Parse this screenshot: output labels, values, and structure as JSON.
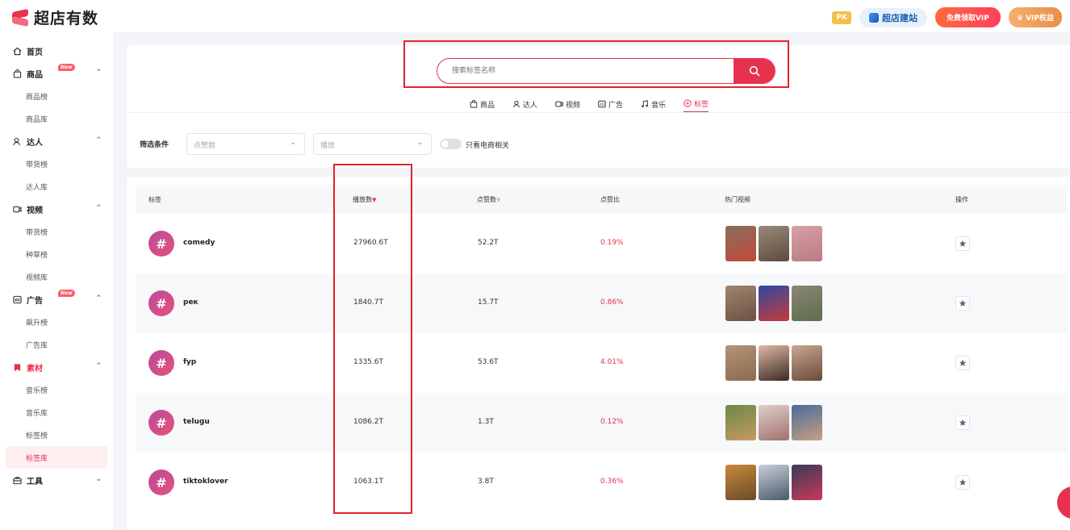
{
  "brand": {
    "name": "超店有数"
  },
  "topbar": {
    "pk": "PK",
    "site_builder": "超店建站",
    "free_vip": "免费领取VIP",
    "vip_rights": "VIP权益"
  },
  "sidebar": {
    "home": "首页",
    "groups": [
      {
        "label": "商品",
        "new": "New",
        "items": [
          "商品榜",
          "商品库"
        ]
      },
      {
        "label": "达人",
        "items": [
          "带货榜",
          "达人库"
        ]
      },
      {
        "label": "视频",
        "items": [
          "带货榜",
          "种草榜",
          "视频库"
        ]
      },
      {
        "label": "广告",
        "new": "New",
        "items": [
          "飙升榜",
          "广告库"
        ]
      },
      {
        "label": "素材",
        "items": [
          "音乐榜",
          "音乐库",
          "标签榜",
          "标签库"
        ]
      },
      {
        "label": "工具",
        "items": []
      }
    ],
    "active_item": "标签库"
  },
  "search": {
    "placeholder": "搜索标签名称"
  },
  "tabs": [
    {
      "label": "商品",
      "icon": "bag-icon"
    },
    {
      "label": "达人",
      "icon": "person-icon"
    },
    {
      "label": "视频",
      "icon": "video-icon"
    },
    {
      "label": "广告",
      "icon": "ad-icon"
    },
    {
      "label": "音乐",
      "icon": "music-icon"
    },
    {
      "label": "标签",
      "icon": "tag-icon",
      "active": true
    }
  ],
  "filters": {
    "label": "筛选条件",
    "likes_placeholder": "点赞数",
    "plays_placeholder": "播放",
    "toggle_label": "只看电商相关"
  },
  "table": {
    "headers": {
      "tag": "标签",
      "plays": "播放数",
      "likes": "点赞数",
      "ratio": "点赞比",
      "hot_videos": "热门视频",
      "actions": "操作"
    },
    "rows": [
      {
        "tag": "comedy",
        "plays": "27960.6T",
        "likes": "52.2T",
        "ratio": "0.19%"
      },
      {
        "tag": "рек",
        "plays": "1840.7T",
        "likes": "15.7T",
        "ratio": "0.86%"
      },
      {
        "tag": "fyp",
        "plays": "1335.6T",
        "likes": "53.6T",
        "ratio": "4.01%"
      },
      {
        "tag": "telugu",
        "plays": "1086.2T",
        "likes": "1.3T",
        "ratio": "0.12%"
      },
      {
        "tag": "tiktoklover",
        "plays": "1063.1T",
        "likes": "3.8T",
        "ratio": "0.36%"
      }
    ]
  },
  "colors": {
    "accent": "#e8304f",
    "highlight_frame": "#e3242b"
  }
}
